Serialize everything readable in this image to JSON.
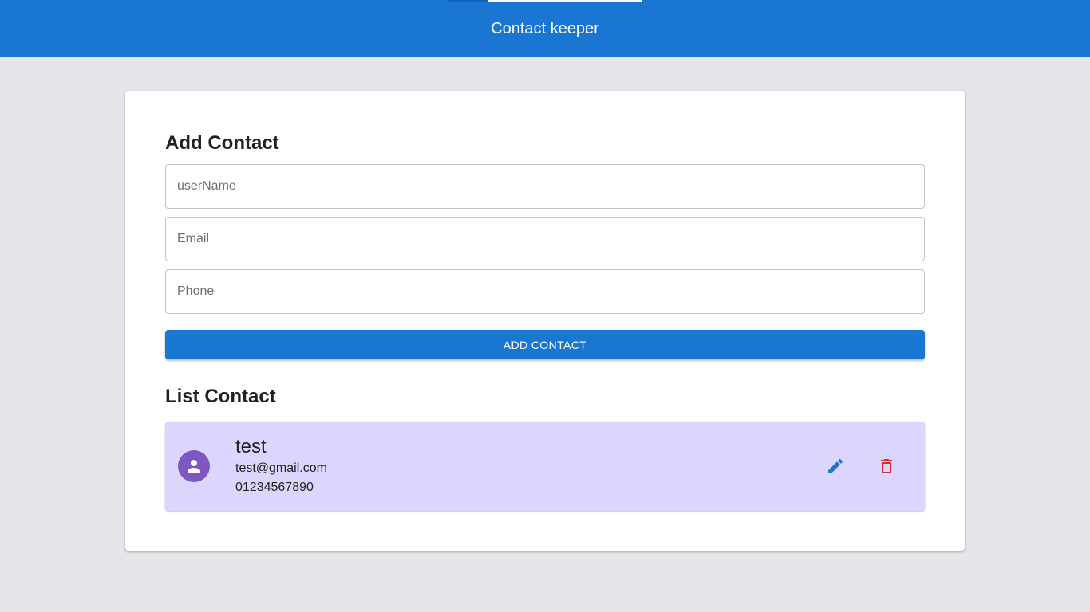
{
  "header": {
    "title": "Contact keeper"
  },
  "form": {
    "title": "Add Contact",
    "fields": [
      {
        "placeholder": "userName",
        "value": ""
      },
      {
        "placeholder": "Email",
        "value": ""
      },
      {
        "placeholder": "Phone",
        "value": ""
      }
    ],
    "submit_label": "ADD CONTACT"
  },
  "list": {
    "title": "List Contact",
    "contacts": [
      {
        "name": "test",
        "email": "test@gmail.com",
        "phone": "01234567890",
        "avatar_icon": "person-icon",
        "edit_icon": "pencil-icon",
        "delete_icon": "trash-icon"
      }
    ]
  },
  "colors": {
    "primary": "#1976d2",
    "background": "#e5e6ea",
    "contact_bg": "#dcd6ff",
    "avatar": "#7e57c2",
    "delete": "#d32f2f"
  }
}
